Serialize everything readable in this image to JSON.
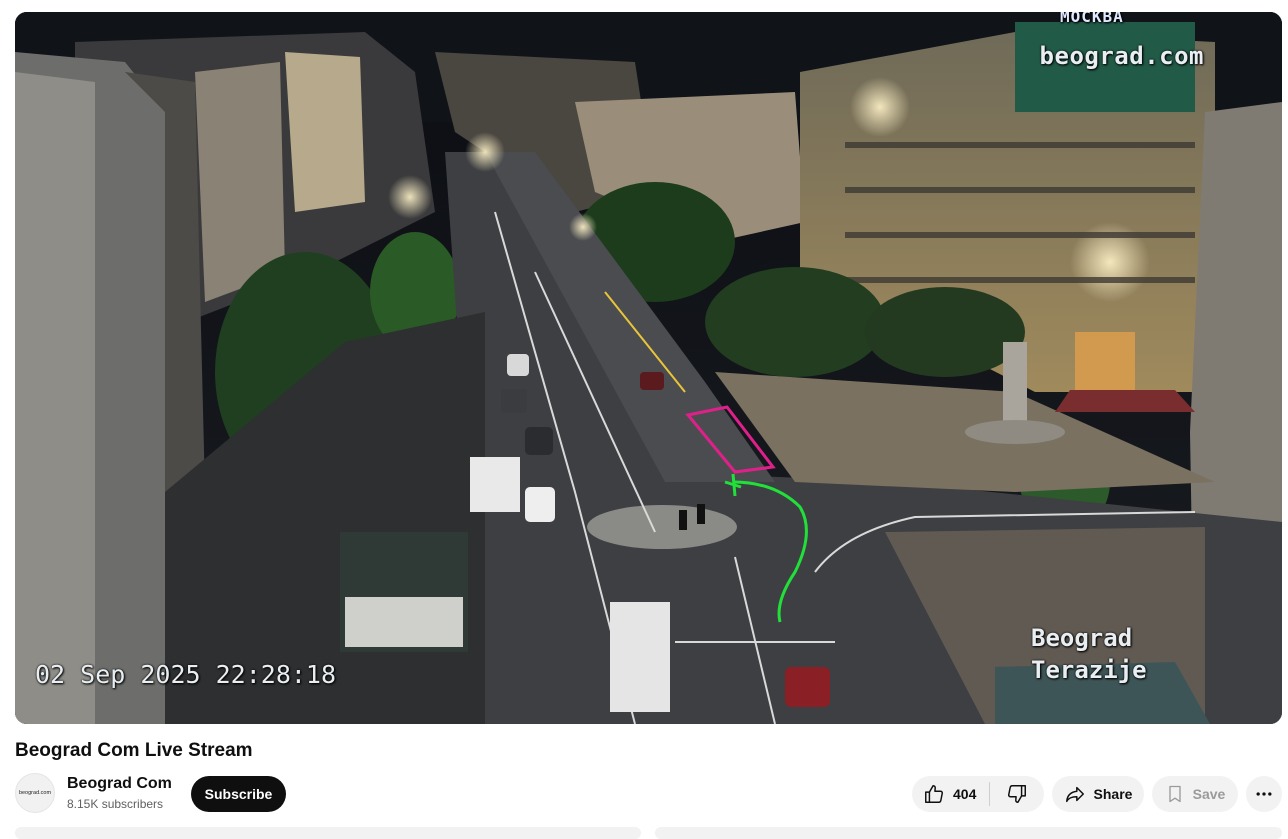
{
  "video": {
    "watermark": "beograd.com",
    "timestamp": "02 Sep 2025 22:28:18",
    "location_line1": "Beograd",
    "location_line2": "Terazije",
    "building_sign": "MOCKBA"
  },
  "title": "Beograd Com Live Stream",
  "channel": {
    "avatar_text": "beograd.com",
    "name": "Beograd Com",
    "subscribers": "8.15K subscribers",
    "subscribe_label": "Subscribe"
  },
  "actions": {
    "like_count": "404",
    "like_icon": "thumbs-up-icon",
    "dislike_icon": "thumbs-down-icon",
    "share_label": "Share",
    "share_icon": "share-arrow-icon",
    "save_label": "Save",
    "save_icon": "bookmark-icon",
    "more_icon": "more-horizontal-icon"
  },
  "colors": {
    "subscribe_bg": "#0f0f0f",
    "pill_bg": "#f2f2f2",
    "overlay_magenta": "#e0208a",
    "overlay_green": "#22e03a"
  }
}
